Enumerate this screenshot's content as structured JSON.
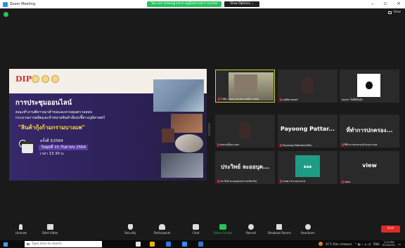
{
  "window": {
    "title": "Zoom Meeting"
  },
  "share_bar": {
    "status": "You are viewing ตลวก.หนูกุ้งปลาเปลาร screen",
    "view_options": "View Options ⌄"
  },
  "top_right": {
    "view_label": "View"
  },
  "slide": {
    "logo": "DIP",
    "title": "การประชุมออนไลน์",
    "sub1": "คณะทำงานพิจารณาคำขอและควบคุมตรวจสอบ",
    "sub2": "กระบวนการผลิตและจำหน่ายสินค้าสิ่งบ่งชี้ทางภูมิศาสตร์",
    "highlight": "\"สินค้ากุ้งก้ามกรามบางแพ\"",
    "line_session": "ครั้งที่ 3/2564",
    "line_date": "วันพุธที่ 15 กันยายน 2564",
    "line_time": "เวลา 13.30 น."
  },
  "tiles": [
    {
      "name": "ไวยิดา หอมนวน(สมาคมกุ้งบางแพ)",
      "big": ""
    },
    {
      "name": "กฤติพร jewel",
      "big": ""
    },
    {
      "name": "พฤกษา โพธิ์ศรีแย้ม",
      "big": ""
    },
    {
      "name": "สหกรณ์กุ้งบางแพ",
      "big": ""
    },
    {
      "name": "Payoong Pattarakul(Pa)",
      "big": "Payoong Pattar..."
    },
    {
      "name": "ที่ทำการปกครองอำเภอบางแพ",
      "big": "ที่ทำการปกครอง..."
    },
    {
      "name": "ประวิทย์ ละออบุตร(ประมงจังหวัด)",
      "big": "ประวิทย์ ละออบุต..."
    },
    {
      "name": "เกษตร อำเภอบางแพ",
      "big": ""
    },
    {
      "name": "view",
      "big": "view"
    }
  ],
  "toolbar": {
    "unmute": "Unmute",
    "start_video": "Start Video",
    "security": "Security",
    "participants": "Participants",
    "participants_count": "9",
    "chat": "Chat",
    "share_screen": "Share Screen",
    "record": "Record",
    "breakout": "Breakout Rooms",
    "reactions": "Reactions",
    "end": "End"
  },
  "taskbar": {
    "search_placeholder": "Type here to search",
    "weather": "31°C Rain showers",
    "lang": "ENG",
    "time": "1:15 PM",
    "date": "9/15/2021"
  },
  "colors": {
    "accent_green": "#25c45a",
    "end_red": "#e02828",
    "active_tile": "#c5d433"
  }
}
